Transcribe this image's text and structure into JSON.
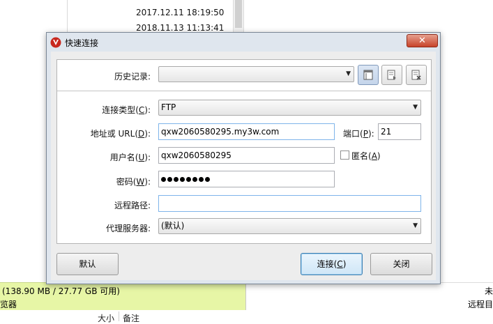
{
  "background": {
    "dates": [
      "2017.12.11 18:19:50",
      "2018.11.13 11:13:41"
    ],
    "status_left_line1": "(138.90 MB / 27.77 GB 可用)",
    "status_left_line2": "览器",
    "status_right_line1": "未",
    "status_right_line2": "远程目",
    "col_size": "大小",
    "col_note": "备注"
  },
  "dialog": {
    "title": "快速连接",
    "close_label": "✕",
    "history": {
      "label": "历史记录:",
      "value": ""
    },
    "type": {
      "label_pre": "连接类型(",
      "key": "C",
      "label_post": "):",
      "value": "FTP"
    },
    "url": {
      "label_pre": "地址或 URL(",
      "key": "D",
      "label_post": "):",
      "value": "qxw2060580295.my3w.com"
    },
    "port": {
      "label_pre": "端口(",
      "key": "P",
      "label_post": "):",
      "value": "21"
    },
    "user": {
      "label_pre": "用户名(",
      "key": "U",
      "label_post": "):",
      "value": "qxw2060580295"
    },
    "anonymous": {
      "label_pre": "匿名(",
      "key": "A",
      "label_post": ")",
      "checked": false
    },
    "password": {
      "label_pre": "密码(",
      "key": "W",
      "label_post": "):",
      "dots": 8
    },
    "remote_path": {
      "label": "远程路径:",
      "value": ""
    },
    "proxy": {
      "label": "代理服务器:",
      "value": "(默认)"
    },
    "buttons": {
      "default_label": "默认",
      "connect_pre": "连接(",
      "connect_key": "C",
      "connect_post": ")",
      "close_label": "关闭"
    }
  },
  "colors": {
    "status_green": "#e7f6a6",
    "dialog_frame": "#dfe6ee",
    "close_red": "#c7432a"
  }
}
